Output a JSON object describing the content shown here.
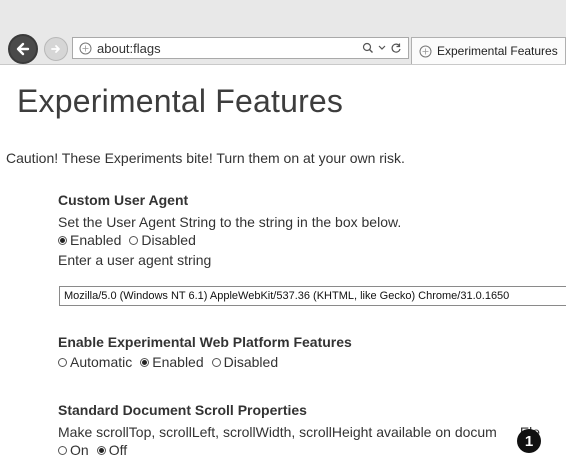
{
  "browser": {
    "address": "about:flags",
    "search_icon": "search-icon",
    "dropdown_icon": "dropdown-arrow-icon",
    "refresh_icon": "refresh-icon",
    "tab_title": "Experimental Features"
  },
  "page": {
    "title": "Experimental Features",
    "caution": "Caution! These Experiments bite! Turn them on at your own risk."
  },
  "sections": {
    "custom_user_agent": {
      "title": "Custom User Agent",
      "description": "Set the User Agent String to the string in the box below.",
      "options": [
        "Enabled",
        "Disabled"
      ],
      "selected": "Enabled",
      "input_label": "Enter a user agent string",
      "input_value": "Mozilla/5.0 (Windows NT 6.1) AppleWebKit/537.36 (KHTML, like Gecko) Chrome/31.0.1650"
    },
    "experimental_web_platform": {
      "title": "Enable Experimental Web Platform Features",
      "options": [
        "Automatic",
        "Enabled",
        "Disabled"
      ],
      "selected": "Enabled"
    },
    "scroll_properties": {
      "title": "Standard Document Scroll Properties",
      "description": "Make scrollTop, scrollLeft, scrollWidth, scrollHeight available on docum",
      "description_trailing": "Ele",
      "options": [
        "On",
        "Off"
      ],
      "selected": "Off"
    }
  },
  "callout": {
    "number": "1"
  }
}
